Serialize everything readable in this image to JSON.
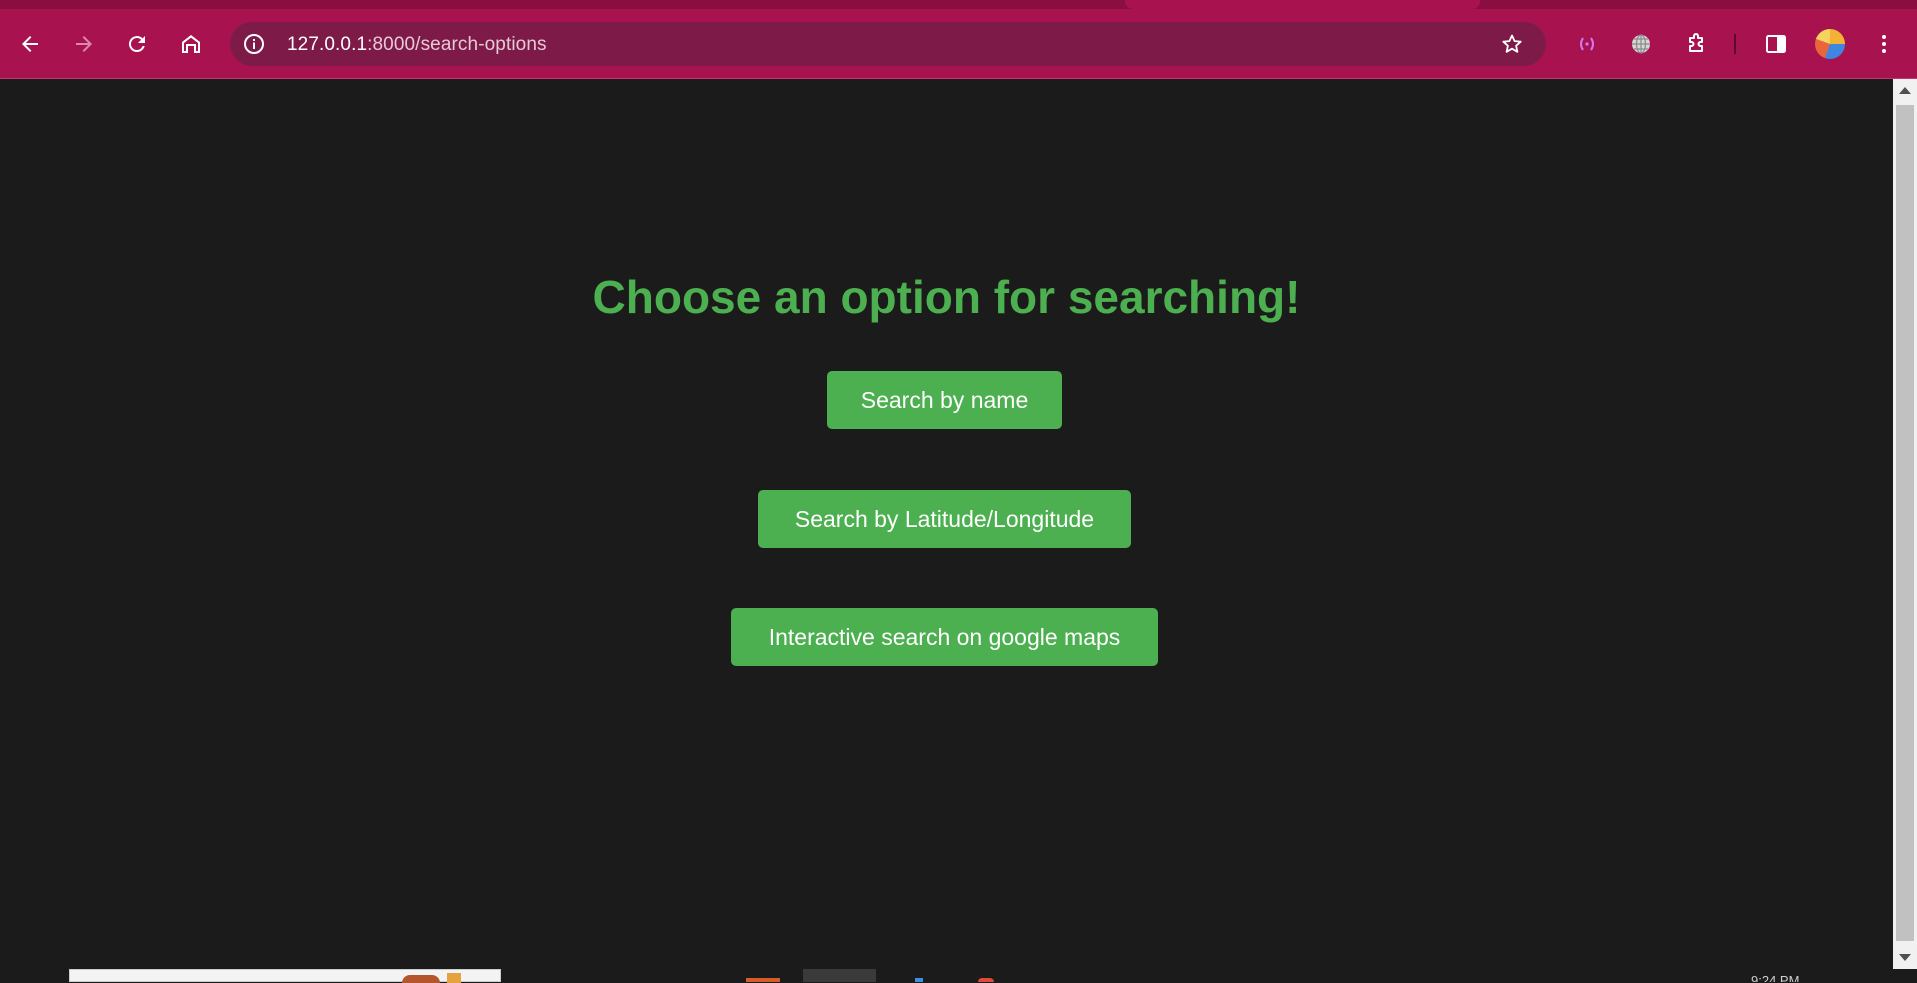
{
  "browser": {
    "url_host": "127.0.0.1",
    "url_rest": ":8000/search-options",
    "theme_color": "#a8134f",
    "icons": {
      "back": "arrow-left-icon",
      "forward": "arrow-right-icon",
      "reload": "reload-icon",
      "home": "home-icon",
      "site_info": "info-icon",
      "bookmark": "star-icon",
      "extension_1": "bracket-extension-icon",
      "extension_2": "globe-icon",
      "extensions": "puzzle-icon",
      "side_panel": "side-panel-icon",
      "menu": "kebab-menu-icon"
    }
  },
  "page": {
    "title": "Choose an option for searching!",
    "title_color": "#4caf50",
    "background": "#1b1b1b",
    "buttons": {
      "search_by_name": "Search by name",
      "search_by_latlng": "Search by Latitude/Longitude",
      "interactive_search": "Interactive search on google maps"
    },
    "button_color": "#4caf50"
  },
  "taskbar": {
    "clock": "9:24 PM"
  }
}
